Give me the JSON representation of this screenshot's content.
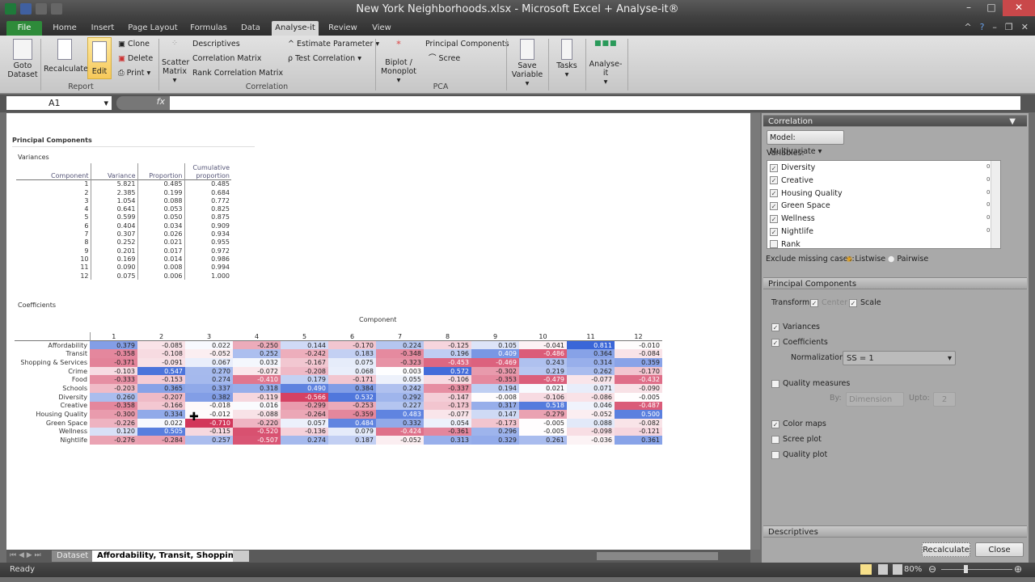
{
  "window": {
    "title": "New York Neighborhoods.xlsx - Microsoft Excel + Analyse-it®"
  },
  "tabs": [
    {
      "label": "File"
    },
    {
      "label": "Home"
    },
    {
      "label": "Insert"
    },
    {
      "label": "Page Layout"
    },
    {
      "label": "Formulas"
    },
    {
      "label": "Data"
    },
    {
      "label": "Analyse-it"
    },
    {
      "label": "Review"
    },
    {
      "label": "View"
    }
  ],
  "ribbon": {
    "goto": "Goto",
    "dataset": "Dataset",
    "recalculate": "Recalculate",
    "edit": "Edit",
    "clone": "Clone",
    "delete": "Delete",
    "print": "Print ▾",
    "report_group": "Report",
    "scatter": "Scatter",
    "matrix": "Matrix ▾",
    "descriptives": "Descriptives",
    "corr_matrix": "Correlation Matrix",
    "rank_corr": "Rank Correlation Matrix",
    "estimate": "Estimate Parameter ▾",
    "test_corr": "Test Correlation ▾",
    "correlation_group": "Correlation",
    "biplot": "Biplot /",
    "monoplot": "Monoplot ▾",
    "principal": "Principal Components",
    "scree": "Scree",
    "pca_group": "PCA",
    "save": "Save",
    "variable": "Variable ▾",
    "tasks": "Tasks",
    "analyseit": "Analyse-it"
  },
  "formula": {
    "cell": "A1",
    "fx": "fx",
    "value": ""
  },
  "report": {
    "title": "Principal Components",
    "variances_label": "Variances",
    "var_headers": [
      "Component",
      "Variance",
      "Proportion",
      "Cumulative",
      "proportion"
    ],
    "variances": [
      [
        "1",
        "5.821",
        "0.485",
        "0.485"
      ],
      [
        "2",
        "2.385",
        "0.199",
        "0.684"
      ],
      [
        "3",
        "1.054",
        "0.088",
        "0.772"
      ],
      [
        "4",
        "0.641",
        "0.053",
        "0.825"
      ],
      [
        "5",
        "0.599",
        "0.050",
        "0.875"
      ],
      [
        "6",
        "0.404",
        "0.034",
        "0.909"
      ],
      [
        "7",
        "0.307",
        "0.026",
        "0.934"
      ],
      [
        "8",
        "0.252",
        "0.021",
        "0.955"
      ],
      [
        "9",
        "0.201",
        "0.017",
        "0.972"
      ],
      [
        "10",
        "0.169",
        "0.014",
        "0.986"
      ],
      [
        "11",
        "0.090",
        "0.008",
        "0.994"
      ],
      [
        "12",
        "0.075",
        "0.006",
        "1.000"
      ]
    ],
    "coef_label": "Coefficients",
    "component_label": "Component",
    "coef_cols": [
      "1",
      "2",
      "3",
      "4",
      "5",
      "6",
      "7",
      "8",
      "9",
      "10",
      "11",
      "12"
    ],
    "coef_rows": [
      {
        "name": "Affordability",
        "values": [
          0.379,
          -0.085,
          0.022,
          -0.25,
          0.144,
          -0.17,
          0.224,
          -0.125,
          0.105,
          -0.041,
          0.811,
          -0.01
        ]
      },
      {
        "name": "Transit",
        "values": [
          -0.358,
          -0.108,
          -0.052,
          0.252,
          -0.242,
          0.183,
          -0.348,
          0.196,
          0.409,
          -0.486,
          0.364,
          -0.084
        ]
      },
      {
        "name": "Shopping & Services",
        "values": [
          -0.371,
          -0.091,
          0.067,
          0.032,
          -0.167,
          0.075,
          -0.323,
          -0.453,
          -0.469,
          0.243,
          0.314,
          0.359
        ]
      },
      {
        "name": "Crime",
        "values": [
          -0.103,
          0.547,
          0.27,
          -0.072,
          -0.208,
          0.068,
          0.003,
          0.572,
          -0.302,
          0.219,
          0.262,
          -0.17
        ]
      },
      {
        "name": "Food",
        "values": [
          -0.333,
          -0.153,
          0.274,
          -0.41,
          0.179,
          -0.171,
          0.055,
          -0.106,
          -0.353,
          -0.479,
          -0.077,
          -0.432
        ]
      },
      {
        "name": "Schools",
        "values": [
          -0.203,
          0.365,
          0.337,
          0.318,
          0.49,
          0.384,
          0.242,
          -0.337,
          0.194,
          0.021,
          0.071,
          -0.09
        ]
      },
      {
        "name": "Diversity",
        "values": [
          0.26,
          -0.207,
          0.382,
          -0.119,
          -0.566,
          0.532,
          0.292,
          -0.147,
          -0.008,
          -0.106,
          -0.086,
          -0.005
        ]
      },
      {
        "name": "Creative",
        "values": [
          -0.358,
          -0.166,
          -0.018,
          0.016,
          -0.299,
          -0.253,
          0.227,
          -0.173,
          0.317,
          0.518,
          0.046,
          -0.487
        ]
      },
      {
        "name": "Housing Quality",
        "values": [
          -0.3,
          0.334,
          -0.012,
          -0.088,
          -0.264,
          -0.359,
          0.483,
          -0.077,
          0.147,
          -0.279,
          -0.052,
          0.5
        ]
      },
      {
        "name": "Green Space",
        "values": [
          -0.226,
          0.022,
          -0.71,
          -0.22,
          0.057,
          0.484,
          0.332,
          0.054,
          -0.173,
          -0.005,
          0.088,
          -0.082
        ]
      },
      {
        "name": "Wellness",
        "values": [
          0.12,
          0.505,
          -0.115,
          -0.52,
          -0.136,
          0.079,
          -0.424,
          -0.361,
          0.296,
          -0.005,
          -0.098,
          -0.121
        ]
      },
      {
        "name": "Nightlife",
        "values": [
          -0.276,
          -0.284,
          0.257,
          -0.507,
          0.274,
          0.187,
          -0.052,
          0.313,
          0.329,
          0.261,
          -0.036,
          0.361
        ]
      }
    ],
    "colors": {
      "positive": "#3a66d8",
      "negative": "#d2365a"
    }
  },
  "sheet_tabs": [
    {
      "label": "Dataset"
    },
    {
      "label": "Affordability, Transit, Shoppin"
    }
  ],
  "status": {
    "text": "Ready",
    "zoom": "80%"
  },
  "panel": {
    "title": "Correlation",
    "model": "Model: Multivariate ▾",
    "variables_label": "Variables:",
    "variables": [
      {
        "name": "Diversity",
        "checked": true
      },
      {
        "name": "Creative",
        "checked": true
      },
      {
        "name": "Housing Quality",
        "checked": true
      },
      {
        "name": "Green Space",
        "checked": true
      },
      {
        "name": "Wellness",
        "checked": true
      },
      {
        "name": "Nightlife",
        "checked": true
      },
      {
        "name": "Rank",
        "checked": false
      }
    ],
    "exclude_label": "Exclude missing cases:",
    "listwise": "Listwise",
    "pairwise": "Pairwise",
    "pc_title": "Principal Components",
    "transform": "Transform:",
    "center": "Center",
    "scale": "Scale",
    "variances": "Variances",
    "coefficients": "Coefficients",
    "normalization": "Normalization:",
    "norm_value": "SS = 1",
    "quality": "Quality measures",
    "by": "By:",
    "by_value": "Dimension",
    "upto": "Upto:",
    "upto_value": "2",
    "color_maps": "Color maps",
    "scree_plot": "Scree plot",
    "quality_plot": "Quality plot",
    "descriptives": "Descriptives",
    "recalculate": "Recalculate",
    "close": "Close"
  }
}
